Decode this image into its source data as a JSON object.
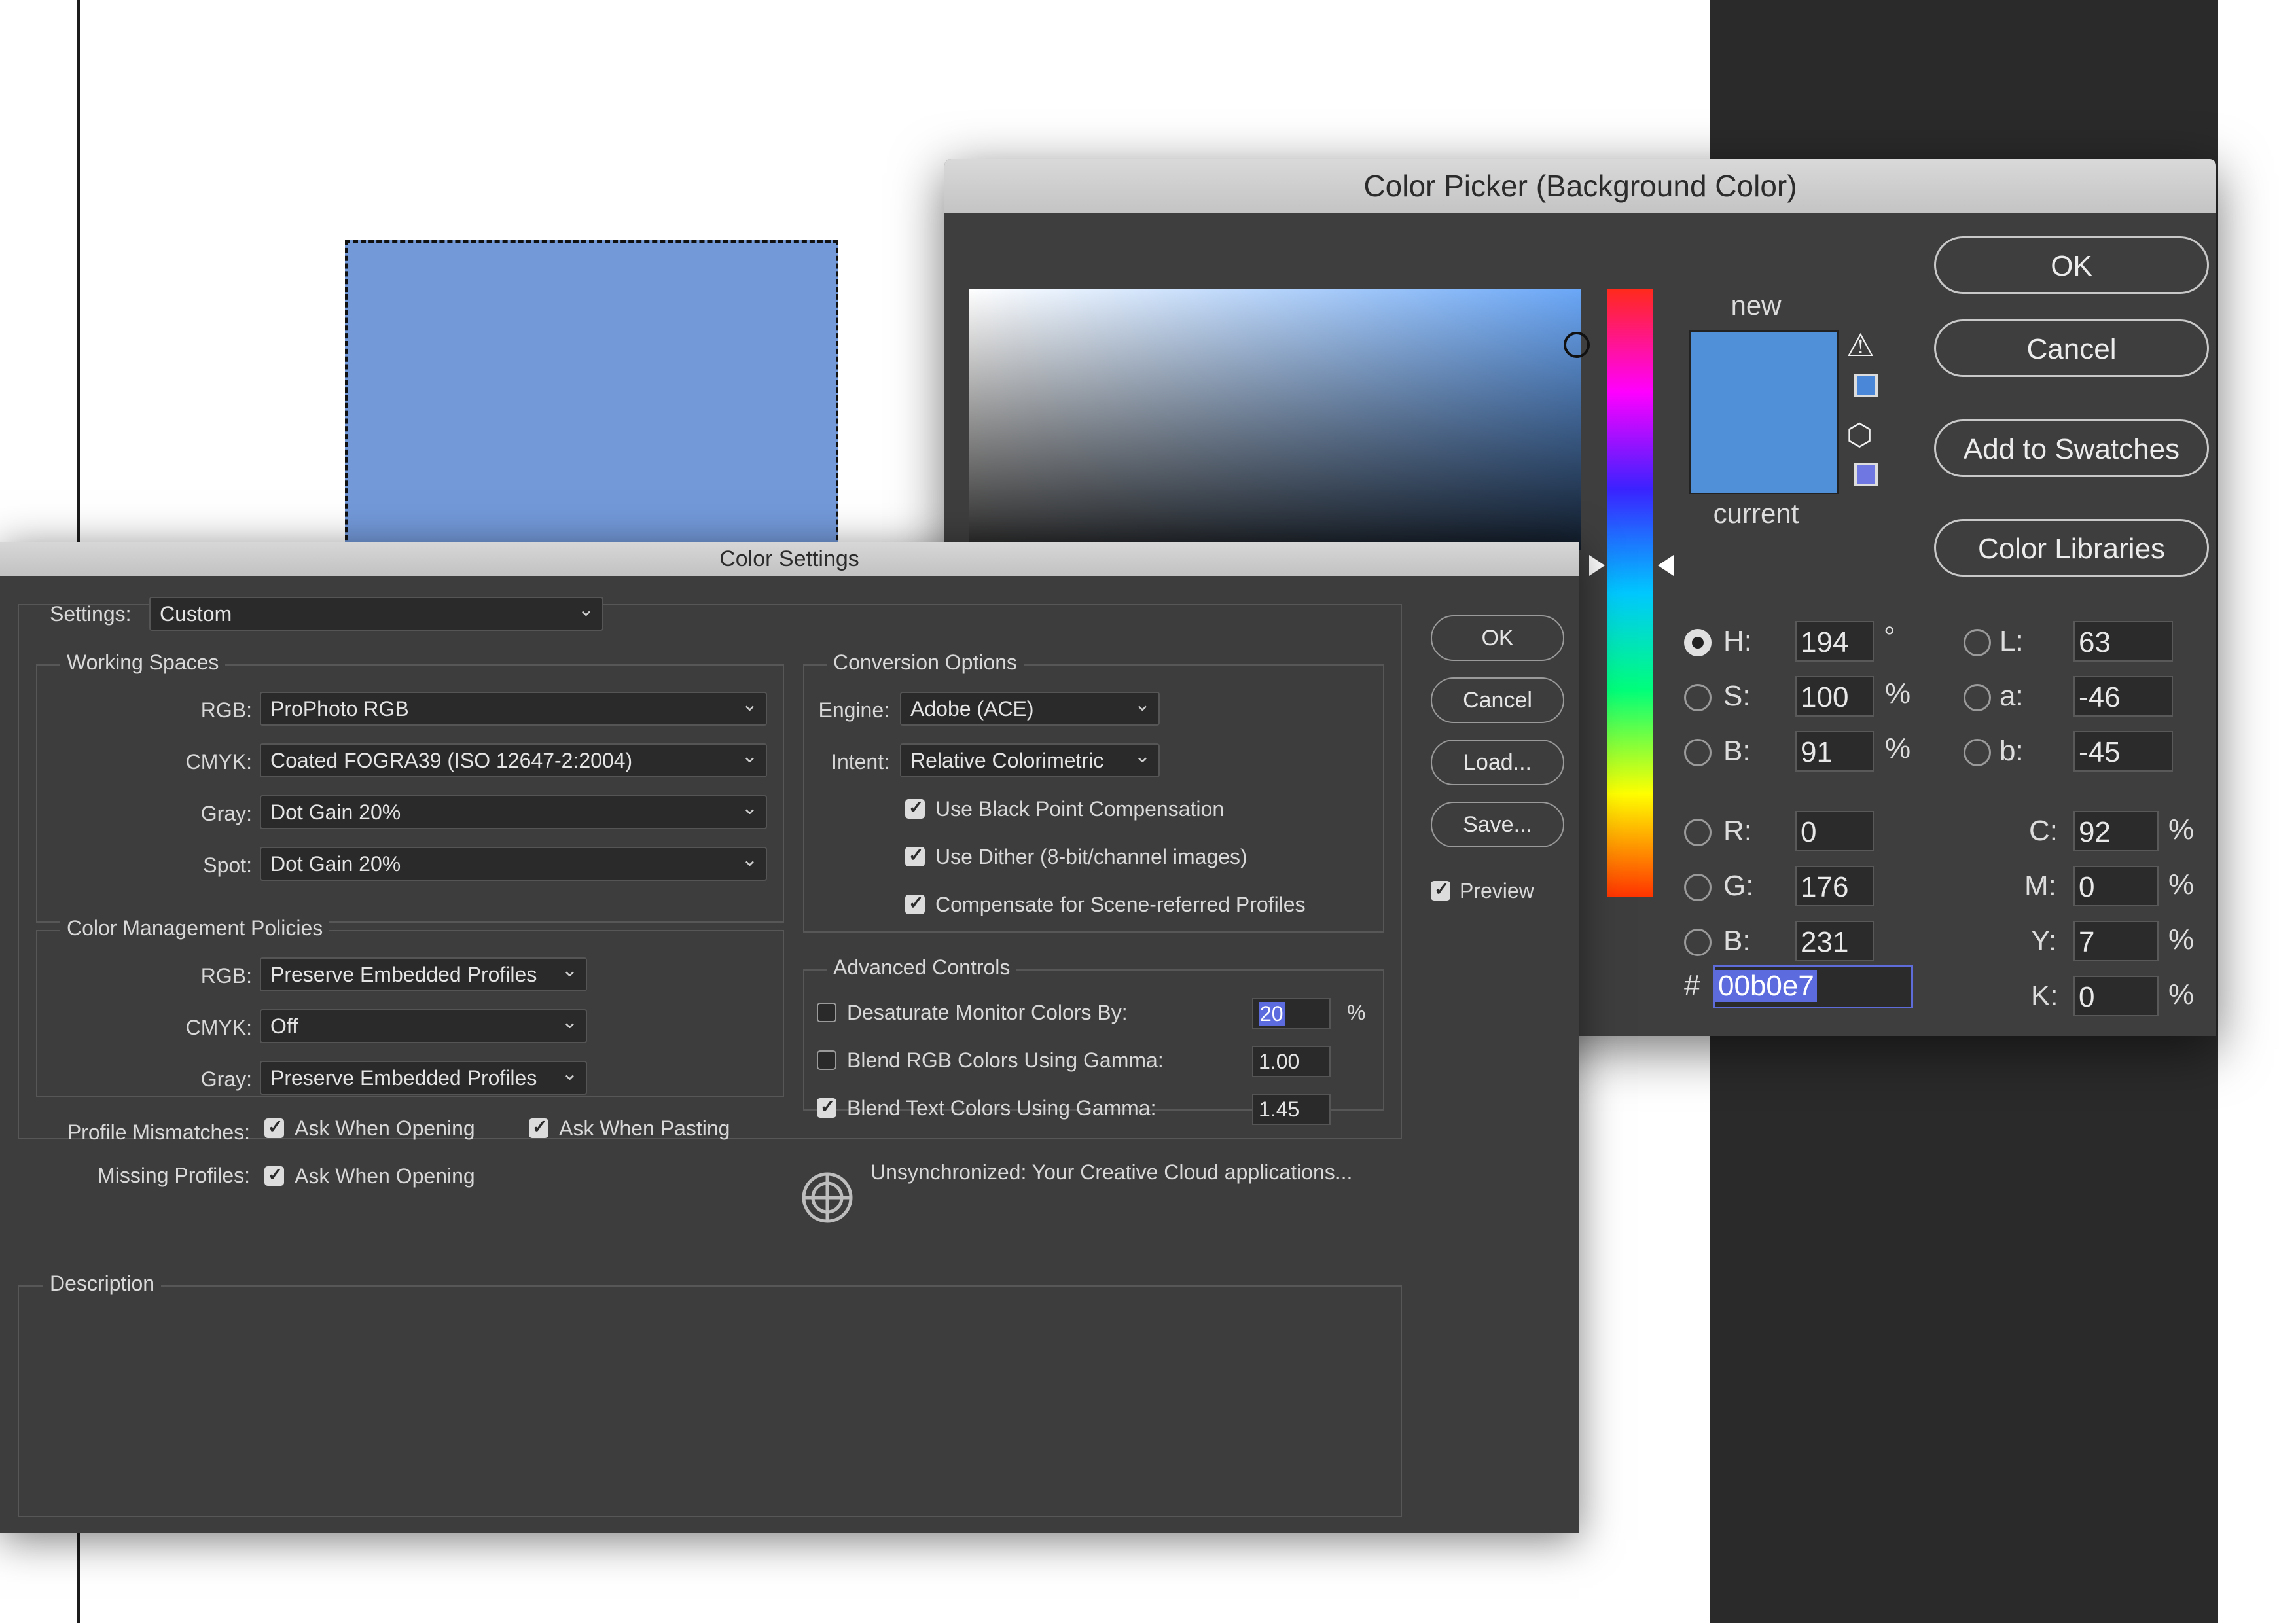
{
  "picker": {
    "title": "Color Picker (Background Color)",
    "new_label": "new",
    "current_label": "current",
    "buttons": {
      "ok": "OK",
      "cancel": "Cancel",
      "add_swatches": "Add to Swatches",
      "color_libraries": "Color Libraries"
    },
    "fields": {
      "h": {
        "label": "H:",
        "value": "194",
        "unit": "°"
      },
      "s": {
        "label": "S:",
        "value": "100",
        "unit": "%"
      },
      "b": {
        "label": "B:",
        "value": "91",
        "unit": "%"
      },
      "r": {
        "label": "R:",
        "value": "0"
      },
      "g": {
        "label": "G:",
        "value": "176"
      },
      "b2": {
        "label": "B:",
        "value": "231"
      },
      "l": {
        "label": "L:",
        "value": "63"
      },
      "a": {
        "label": "a:",
        "value": "-46"
      },
      "lb": {
        "label": "b:",
        "value": "-45"
      },
      "c": {
        "label": "C:",
        "value": "92",
        "unit": "%"
      },
      "m": {
        "label": "M:",
        "value": "0",
        "unit": "%"
      },
      "y": {
        "label": "Y:",
        "value": "7",
        "unit": "%"
      },
      "k": {
        "label": "K:",
        "value": "0",
        "unit": "%"
      }
    },
    "hex_label": "#",
    "hex_value": "00b0e7",
    "icons": {
      "warning": "warning-triangle-icon",
      "cube": "web-safe-cube-icon"
    }
  },
  "settings": {
    "title": "Color Settings",
    "settings_label": "Settings:",
    "settings_value": "Custom",
    "working_spaces": {
      "title": "Working Spaces",
      "rgb_label": "RGB:",
      "rgb_value": "ProPhoto RGB",
      "cmyk_label": "CMYK:",
      "cmyk_value": "Coated FOGRA39 (ISO 12647-2:2004)",
      "gray_label": "Gray:",
      "gray_value": "Dot Gain 20%",
      "spot_label": "Spot:",
      "spot_value": "Dot Gain 20%"
    },
    "policies": {
      "title": "Color Management Policies",
      "rgb_label": "RGB:",
      "rgb_value": "Preserve Embedded Profiles",
      "cmyk_label": "CMYK:",
      "cmyk_value": "Off",
      "gray_label": "Gray:",
      "gray_value": "Preserve Embedded Profiles",
      "mismatch_label": "Profile Mismatches:",
      "ask_opening": "Ask When Opening",
      "ask_pasting": "Ask When Pasting",
      "missing_label": "Missing Profiles:",
      "missing_ask_opening": "Ask When Opening"
    },
    "conversion": {
      "title": "Conversion Options",
      "engine_label": "Engine:",
      "engine_value": "Adobe (ACE)",
      "intent_label": "Intent:",
      "intent_value": "Relative Colorimetric",
      "black_point": "Use Black Point Compensation",
      "dither": "Use Dither (8-bit/channel images)",
      "scene": "Compensate for Scene-referred Profiles"
    },
    "advanced": {
      "title": "Advanced Controls",
      "desaturate_label": "Desaturate Monitor Colors By:",
      "desaturate_value": "20",
      "desaturate_unit": "%",
      "blend_rgb_label": "Blend RGB Colors Using Gamma:",
      "blend_rgb_value": "1.00",
      "blend_text_label": "Blend Text Colors Using Gamma:",
      "blend_text_value": "1.45"
    },
    "sync_text": "Unsynchronized: Your Creative Cloud applications...",
    "description_title": "Description",
    "buttons": {
      "ok": "OK",
      "cancel": "Cancel",
      "load": "Load...",
      "save": "Save..."
    },
    "preview_label": "Preview"
  },
  "colors": {
    "new_color": "#4f90d9",
    "canvas_swatch": "#7399d9",
    "hex_highlight": "#5c6bde"
  }
}
